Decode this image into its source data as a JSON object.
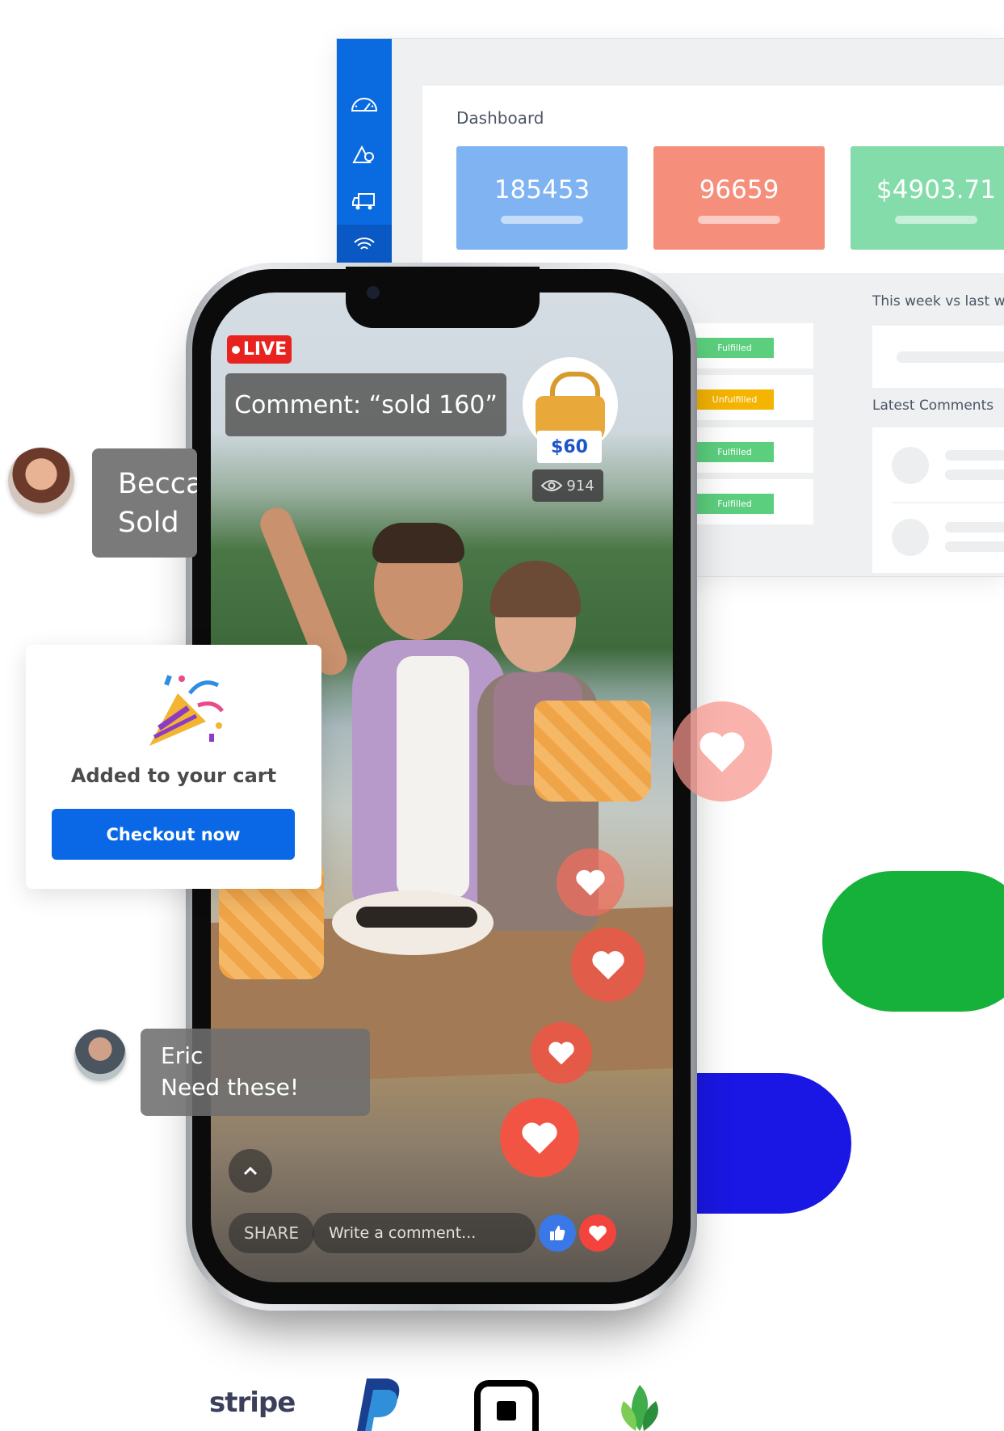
{
  "dashboard": {
    "title": "Dashboard",
    "stats": [
      {
        "value": "185453",
        "color": "#7fb3f2"
      },
      {
        "value": "96659",
        "color": "#f58f7c"
      },
      {
        "value": "$4903.71",
        "color": "#85dcab"
      }
    ],
    "orders": [
      {
        "status": "Fulfilled",
        "color": "#5ccf7e"
      },
      {
        "status": "Unfulfilled",
        "color": "#f5b400"
      },
      {
        "status": "Fulfilled",
        "color": "#5ccf7e"
      },
      {
        "status": "Fulfilled",
        "color": "#5ccf7e"
      }
    ],
    "week_label": "This week vs last we",
    "latest_comments_label": "Latest Comments",
    "sidebar_icons": [
      "speedometer-icon",
      "mountain-icon",
      "truck-icon",
      "wifi-icon"
    ]
  },
  "stream": {
    "live_label": "LIVE",
    "comment_prompt": "Comment: “sold 160”",
    "product_price": "$60",
    "viewer_count": "914",
    "share_label": "SHARE",
    "comment_placeholder": "Write a comment..."
  },
  "chat": {
    "becca_line1": "Becca",
    "becca_line2": "Sold",
    "eric_name": "Eric",
    "eric_message": "Need these!"
  },
  "cart": {
    "message": "Added to your cart",
    "checkout_label": "Checkout now"
  },
  "payment_logos": {
    "stripe": "stripe",
    "others": [
      "paypal-logo",
      "square-logo",
      "green-leaf-logo"
    ]
  },
  "colors": {
    "brand_blue": "#0a68e6",
    "live_red": "#e8231f",
    "heart_red": "#f2443d",
    "blob_green": "#16b13a",
    "blob_blue": "#1a17e4"
  }
}
